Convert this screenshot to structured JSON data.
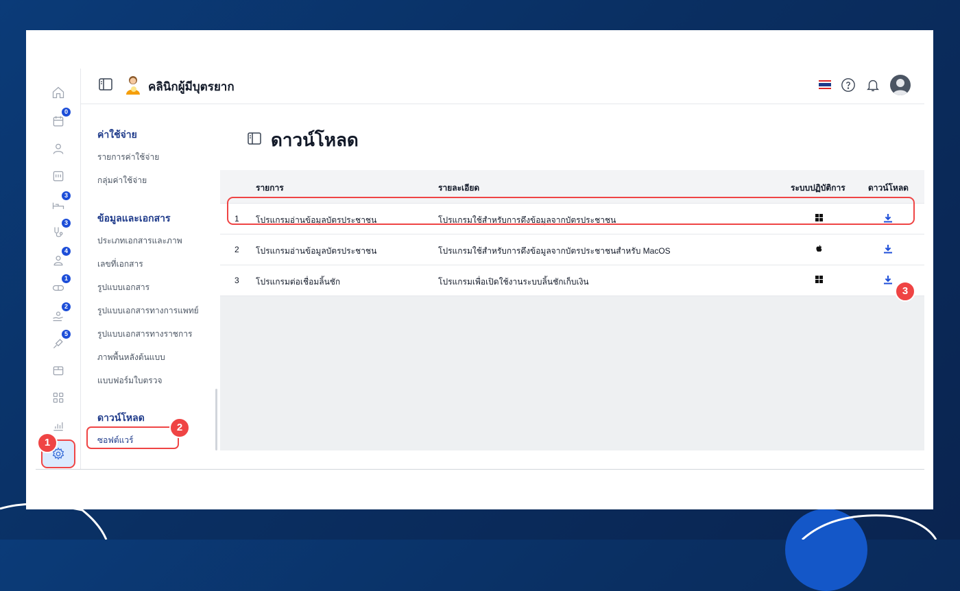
{
  "header": {
    "clinic_name": "คลินิกผู้มีบุตรยาก"
  },
  "rail": {
    "badges": {
      "appointments": "0",
      "equipment": "3",
      "stethoscope": "3",
      "patients": "4",
      "medicine": "1",
      "care": "2",
      "vaccine": "5"
    }
  },
  "submenu": {
    "sections": [
      {
        "title": "ค่าใช้จ่าย",
        "items": [
          "รายการค่าใช้จ่าย",
          "กลุ่มค่าใช้จ่าย"
        ]
      },
      {
        "title": "ข้อมูลและเอกสาร",
        "items": [
          "ประเภทเอกสารและภาพ",
          "เลขที่เอกสาร",
          "รูปแบบเอกสาร",
          "รูปแบบเอกสารทางการแพทย์",
          "รูปแบบเอกสารทางราชการ",
          "ภาพพื้นหลังต้นแบบ",
          "แบบฟอร์มใบตรวจ"
        ]
      },
      {
        "title": "ดาวน์โหลด",
        "items": [
          "ซอฟต์แวร์"
        ]
      }
    ]
  },
  "main": {
    "title": "ดาวน์โหลด",
    "columns": {
      "item": "รายการ",
      "detail": "รายละเอียด",
      "os": "ระบบปฏิบัติการ",
      "download": "ดาวน์โหลด"
    },
    "rows": [
      {
        "no": "1",
        "name": "โปรแกรมอ่านข้อมูลบัตรประชาชน",
        "detail": "โปรแกรมใช้สำหรับการดึงข้อมูลจากบัตรประชาชน",
        "os": "windows-icon"
      },
      {
        "no": "2",
        "name": "โปรแกรมอ่านข้อมูลบัตรประชาชน",
        "detail": "โปรแกรมใช้สำหรับการดึงข้อมูลจากบัตรประชาชนสำหรับ MacOS",
        "os": "apple-icon"
      },
      {
        "no": "3",
        "name": "โปรแกรมต่อเชื่อมลิ้นชัก",
        "detail": "โปรแกรมเพื่อเปิดใช้งานระบบลิ้นชักเก็บเงิน",
        "os": "windows-icon"
      }
    ]
  },
  "steps": [
    "1",
    "2",
    "3"
  ],
  "colors": {
    "accent": "#1d4ed8",
    "highlight": "#ef4444",
    "background": "#0b3b78"
  }
}
